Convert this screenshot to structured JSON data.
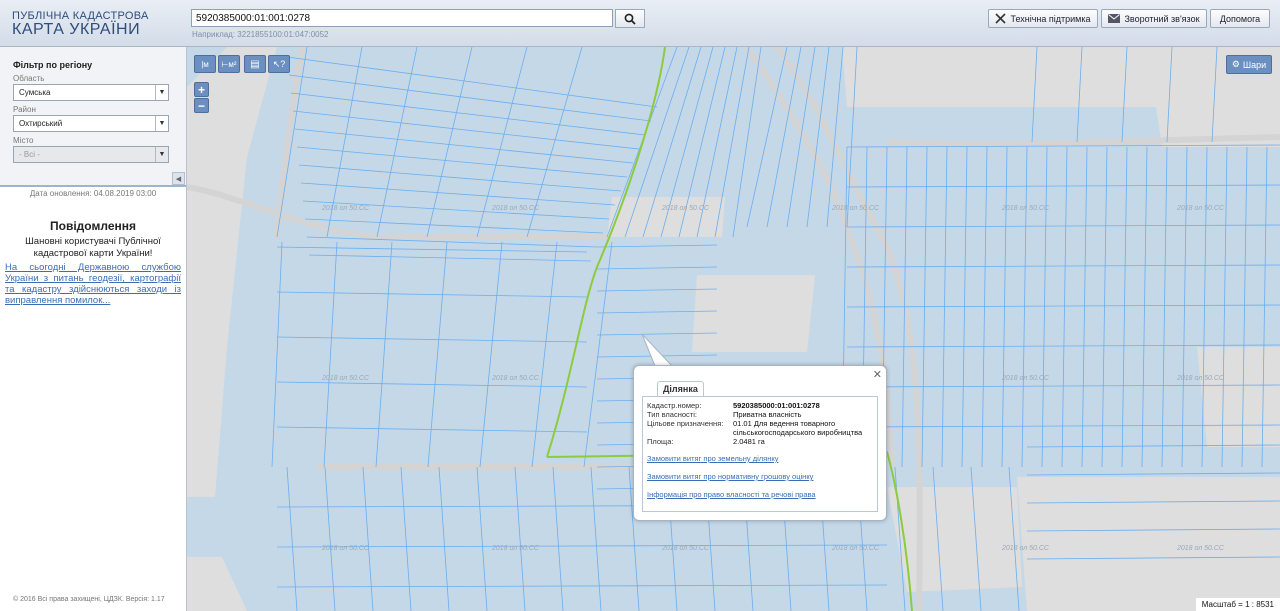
{
  "header": {
    "logo_line1": "ПУБЛІЧНА КАДАСТРОВА",
    "logo_line2": "КАРТА УКРАЇНИ",
    "search_value": "5920385000:01:001:0278",
    "example_text": "Наприклад: 3221855100:01:047:0052",
    "search_icon": "search-icon",
    "buttons": [
      {
        "label": "Технічна підтримка",
        "icon": "tools-icon"
      },
      {
        "label": "Зворотний зв'язок",
        "icon": "envelope-icon"
      },
      {
        "label": "Допомога",
        "icon": ""
      }
    ]
  },
  "sidebar": {
    "filter_title": "Фільтр по регіону",
    "region_label": "Область",
    "region_value": "Сумська",
    "district_label": "Район",
    "district_value": "Охтирський",
    "city_label": "Місто",
    "city_value": "- Всі -",
    "updated": "Дата оновлення: 04.08.2019 03:00",
    "notice_title": "Повідомлення",
    "notice_text": "Шановні користувачі Публічної кадастрової карти України!",
    "notice_link": "На сьогодні Державною службою України з питань геодезії, картографії та кадастру здійснюються заходи із виправлення помилок...",
    "copyright": "© 2016 Всі права захищені, ЦДЗК. Версія: 1.17"
  },
  "map": {
    "toolbar": [
      "ruler-m-icon",
      "ruler-area-icon",
      "print-icon",
      "pointer-help-icon"
    ],
    "zoom_in": "+",
    "zoom_out": "−",
    "layers_label": "Шари",
    "layers_icon": "gear-icon",
    "scale_text": "Масштаб = 1 : 8531",
    "watermark": "2018 ол 50.СС",
    "colors": {
      "parcel_fill": "#c5d8e8",
      "parcel_line": "#6aaef0",
      "boundary": "#8ccc3c",
      "road": "#d9d9d9"
    }
  },
  "popup": {
    "tab": "Ділянка",
    "rows": [
      {
        "k": "Кадастр.номер:",
        "v": "5920385000:01:001:0278"
      },
      {
        "k": "Тип власності:",
        "v": "Приватна власність"
      },
      {
        "k": "Цільове призначення:",
        "v": "01.01 Для ведення товарного сільськогосподарського виробництва"
      },
      {
        "k": "Площа:",
        "v": "2.0481 га"
      }
    ],
    "links": [
      "Замовити витяг про земельну ділянку",
      "Замовити витяг про нормативну грошову оцінку",
      "Інформація про право власності та речові права"
    ]
  }
}
